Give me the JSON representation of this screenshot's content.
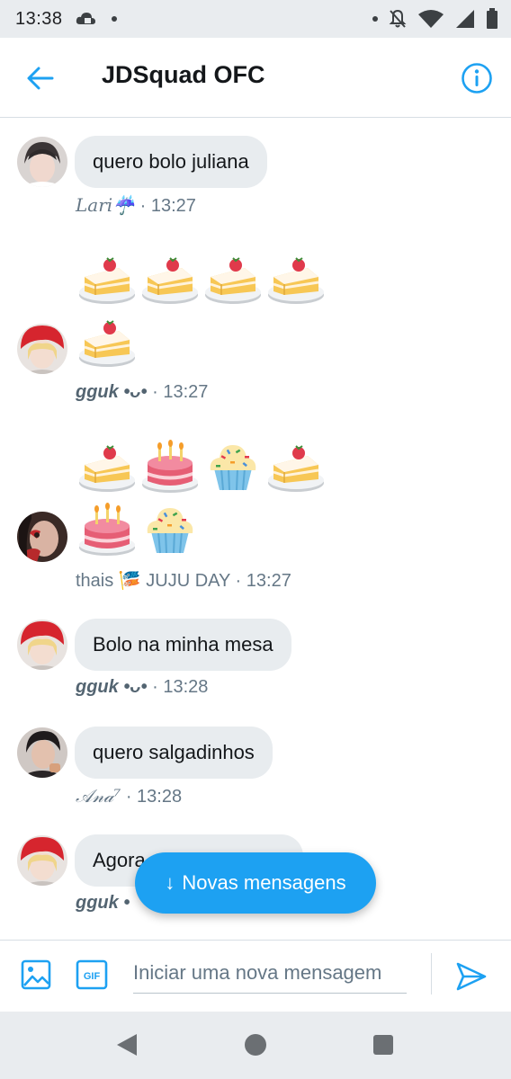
{
  "status_bar": {
    "time": "13:38"
  },
  "header": {
    "title": "JDSquad OFC"
  },
  "messages": [
    {
      "text": "quero bolo juliana",
      "sender": "Lari☔",
      "time": "13:27"
    },
    {
      "sender": "gguk •ᴗ•",
      "time": "13:27"
    },
    {
      "sender": "thais 🎏 JUJU DAY",
      "time": "13:27"
    },
    {
      "text": "Bolo na minha mesa",
      "sender": "gguk •ᴗ•",
      "time": "13:28"
    },
    {
      "text": "quero salgadinhos",
      "sender": "𝒜𝓃𝒶⁷",
      "time": "13:28"
    },
    {
      "text": "Agora",
      "sender": "gguk •",
      "time": ""
    }
  ],
  "meta_separator": "·",
  "new_messages_pill": {
    "label": "Novas mensagens",
    "arrow": "↓"
  },
  "composer": {
    "placeholder": "Iniciar uma nova mensagem",
    "gif_label": "GIF"
  },
  "colors": {
    "accent": "#1da1f2",
    "bubble": "#e8ecef",
    "meta": "#657786"
  }
}
